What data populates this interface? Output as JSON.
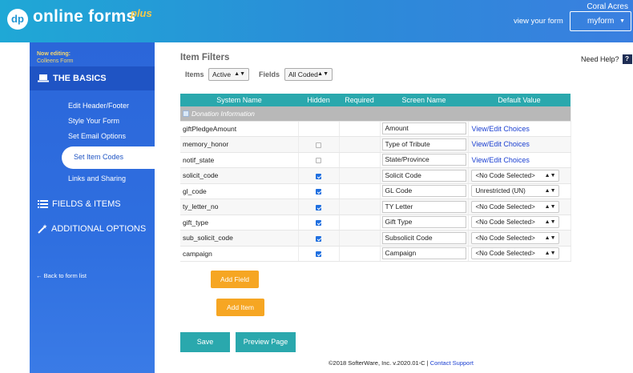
{
  "header": {
    "logo_mark": "dp",
    "logo_text": "online forms",
    "logo_plus": "plus",
    "org_name": "Coral Acres",
    "view_form_label": "view your form",
    "form_select_value": "myform"
  },
  "sidebar": {
    "now_editing_label": "Now editing:",
    "form_name": "Colleens Form",
    "basics_title": "THE BASICS",
    "items": [
      {
        "label": "Edit Header/Footer"
      },
      {
        "label": "Style Your Form"
      },
      {
        "label": "Set Email Options"
      },
      {
        "label": "Set Item Codes"
      },
      {
        "label": "Links and Sharing"
      }
    ],
    "fields_title": "FIELDS & ITEMS",
    "additional_title": "ADDITIONAL OPTIONS",
    "back_link": "Back to form list"
  },
  "main": {
    "title": "Item Filters",
    "need_help": "Need Help?",
    "help_icon_glyph": "?",
    "filters": {
      "items_label": "Items",
      "items_value": "Active",
      "fields_label": "Fields",
      "fields_value": "All Coded"
    },
    "table": {
      "headers": [
        "System Name",
        "Hidden",
        "Required",
        "Screen Name",
        "Default Value"
      ],
      "group_label": "Donation Information",
      "rows": [
        {
          "system": "giftPledgeAmount",
          "hidden": null,
          "screen": "Amount",
          "default_type": "link",
          "default": "View/Edit Choices"
        },
        {
          "system": "memory_honor",
          "hidden": false,
          "screen": "Type of Tribute",
          "default_type": "link",
          "default": "View/Edit Choices"
        },
        {
          "system": "notif_state",
          "hidden": false,
          "screen": "State/Province",
          "default_type": "link",
          "default": "View/Edit Choices"
        },
        {
          "system": "solicit_code",
          "hidden": true,
          "screen": "Solicit Code",
          "default_type": "select",
          "default": "<No Code Selected>"
        },
        {
          "system": "gl_code",
          "hidden": true,
          "screen": "GL Code",
          "default_type": "select",
          "default": "Unrestricted (UN)"
        },
        {
          "system": "ty_letter_no",
          "hidden": true,
          "screen": "TY Letter",
          "default_type": "select",
          "default": "<No Code Selected>"
        },
        {
          "system": "gift_type",
          "hidden": true,
          "screen": "Gift Type",
          "default_type": "select",
          "default": "<No Code Selected>"
        },
        {
          "system": "sub_solicit_code",
          "hidden": true,
          "screen": "Subsolicit Code",
          "default_type": "select",
          "default": "<No Code Selected>"
        },
        {
          "system": "campaign",
          "hidden": true,
          "screen": "Campaign",
          "default_type": "select",
          "default": "<No Code Selected>"
        }
      ]
    },
    "add_field_label": "Add Field",
    "add_item_label": "Add Item",
    "save_label": "Save",
    "preview_label": "Preview Page"
  },
  "footer": {
    "copyright": "©2018 SofterWare, Inc. v.2020.01-C |",
    "support_link": "Contact Support"
  },
  "colors": {
    "header_gradient_start": "#1fa8d6",
    "sidebar_blue": "#2b66d9",
    "table_header_teal": "#2aa8ad",
    "accent_orange": "#f6a623",
    "link_blue": "#1a3fd1"
  }
}
